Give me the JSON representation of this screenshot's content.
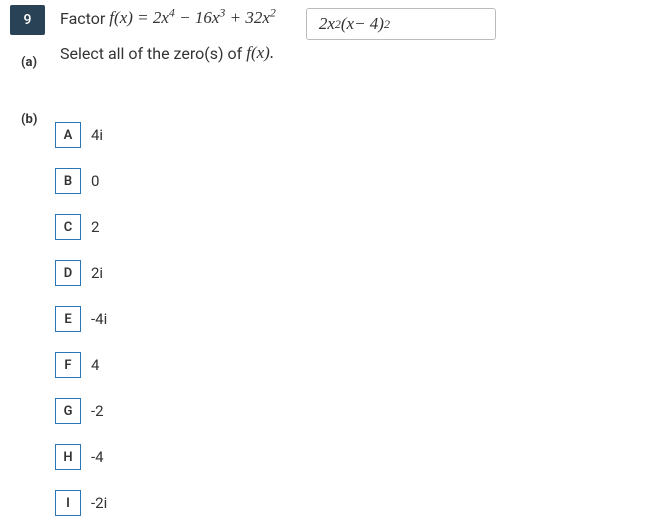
{
  "question_number": "9",
  "prompt_prefix": "Factor ",
  "prompt_math": "f(x) = 2x⁴ − 16x³ + 32x²",
  "answer_input": "2x²(x − 4)²",
  "part_a": {
    "label": "(a)",
    "text_prefix": "Select all of the zero(s) of ",
    "text_math": "f(x)."
  },
  "part_b": {
    "label": "(b)"
  },
  "choices": [
    {
      "letter": "A",
      "label": "4i"
    },
    {
      "letter": "B",
      "label": "0"
    },
    {
      "letter": "C",
      "label": "2"
    },
    {
      "letter": "D",
      "label": "2i"
    },
    {
      "letter": "E",
      "label": "-4i"
    },
    {
      "letter": "F",
      "label": "4"
    },
    {
      "letter": "G",
      "label": "-2"
    },
    {
      "letter": "H",
      "label": "-4"
    },
    {
      "letter": "I",
      "label": "-2i"
    }
  ]
}
